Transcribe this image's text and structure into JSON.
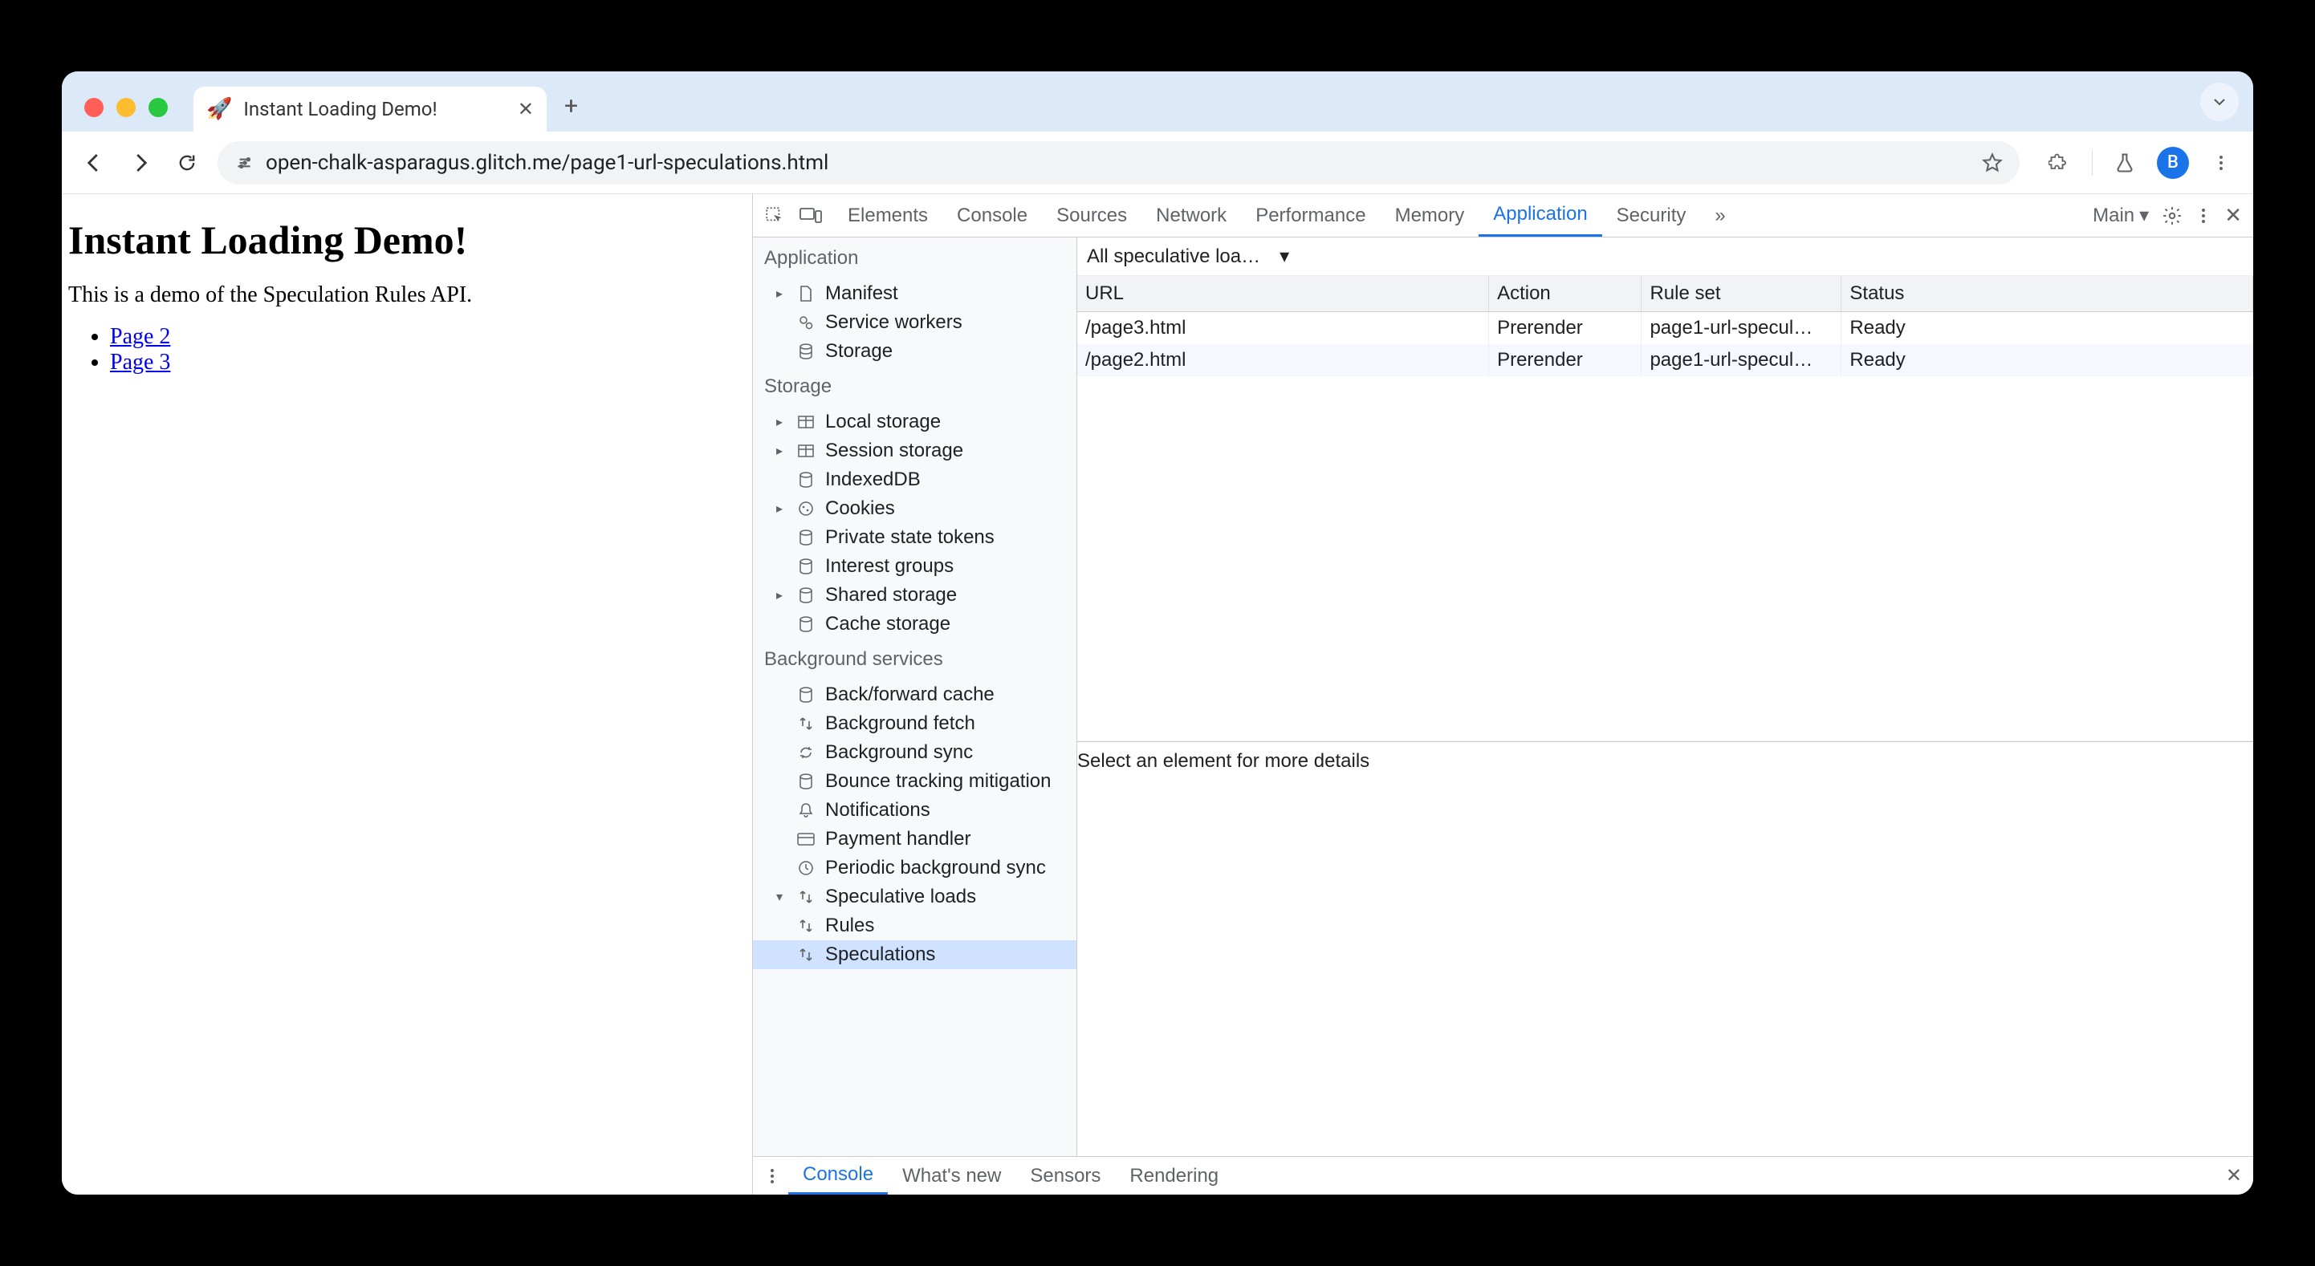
{
  "browser": {
    "tab": {
      "favicon": "🚀",
      "title": "Instant Loading Demo!"
    },
    "url": "open-chalk-asparagus.glitch.me/page1-url-speculations.html",
    "avatar_letter": "B"
  },
  "page": {
    "heading": "Instant Loading Demo!",
    "intro": "This is a demo of the Speculation Rules API.",
    "links": [
      {
        "label": "Page 2"
      },
      {
        "label": "Page 3"
      }
    ]
  },
  "devtools": {
    "tabs": [
      "Elements",
      "Console",
      "Sources",
      "Network",
      "Performance",
      "Memory",
      "Application",
      "Security"
    ],
    "active_tab": "Application",
    "target_label": "Main",
    "sidebar": {
      "application": {
        "title": "Application",
        "items": [
          "Manifest",
          "Service workers",
          "Storage"
        ]
      },
      "storage": {
        "title": "Storage",
        "items": [
          "Local storage",
          "Session storage",
          "IndexedDB",
          "Cookies",
          "Private state tokens",
          "Interest groups",
          "Shared storage",
          "Cache storage"
        ]
      },
      "background": {
        "title": "Background services",
        "items": [
          "Back/forward cache",
          "Background fetch",
          "Background sync",
          "Bounce tracking mitigation",
          "Notifications",
          "Payment handler",
          "Periodic background sync"
        ],
        "speculative": {
          "label": "Speculative loads",
          "children": [
            "Rules",
            "Speculations"
          ],
          "selected": "Speculations"
        }
      }
    },
    "filter_label": "All speculative loa…",
    "table": {
      "headers": [
        "URL",
        "Action",
        "Rule set",
        "Status"
      ],
      "rows": [
        {
          "url": "/page3.html",
          "action": "Prerender",
          "ruleset": "page1-url-specul…",
          "status": "Ready"
        },
        {
          "url": "/page2.html",
          "action": "Prerender",
          "ruleset": "page1-url-specul…",
          "status": "Ready"
        }
      ]
    },
    "detail_placeholder": "Select an element for more details",
    "drawer_tabs": [
      "Console",
      "What's new",
      "Sensors",
      "Rendering"
    ],
    "drawer_active": "Console"
  }
}
